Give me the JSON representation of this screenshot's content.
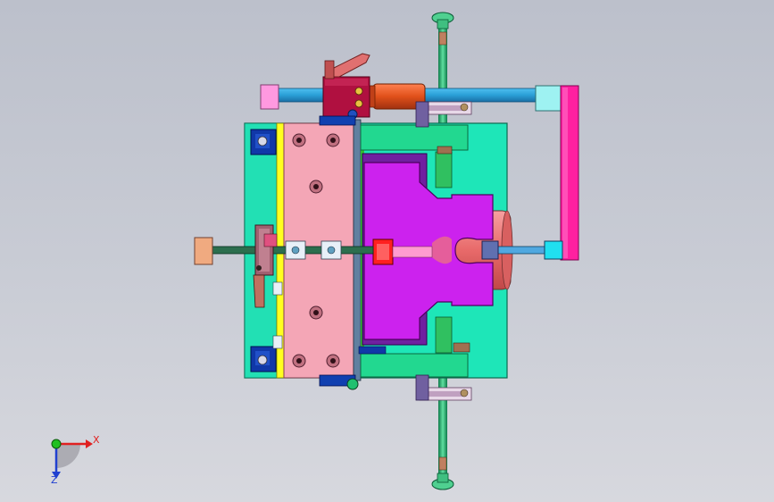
{
  "viewport": {
    "background_top": "#bcc0cb",
    "background_bottom": "#d7d8de"
  },
  "triad": {
    "x_label": "X",
    "z_label": "Z",
    "x_color": "#e02020",
    "y_color": "#20c020",
    "z_color": "#2040d0"
  },
  "colors": {
    "base_plate": "#1ee6b8",
    "core_plate": "#f4a6b6",
    "cavity_insert": "#cc22ee",
    "rail_bar": "#2a9fd6",
    "guide_pillar": "#20b070",
    "clamp_block": "#b01040",
    "cylinder": "#e0501a",
    "side_arm": "#ff20a0",
    "pale_cyan_block": "#9ef2f2",
    "pink_block": "#ff99e0",
    "peach_block": "#f0aa80",
    "yellow_strip": "#ffff20",
    "blue_block": "#1038a8",
    "salmon_boss": "#f07878",
    "red_sprue": "#ff2020"
  }
}
